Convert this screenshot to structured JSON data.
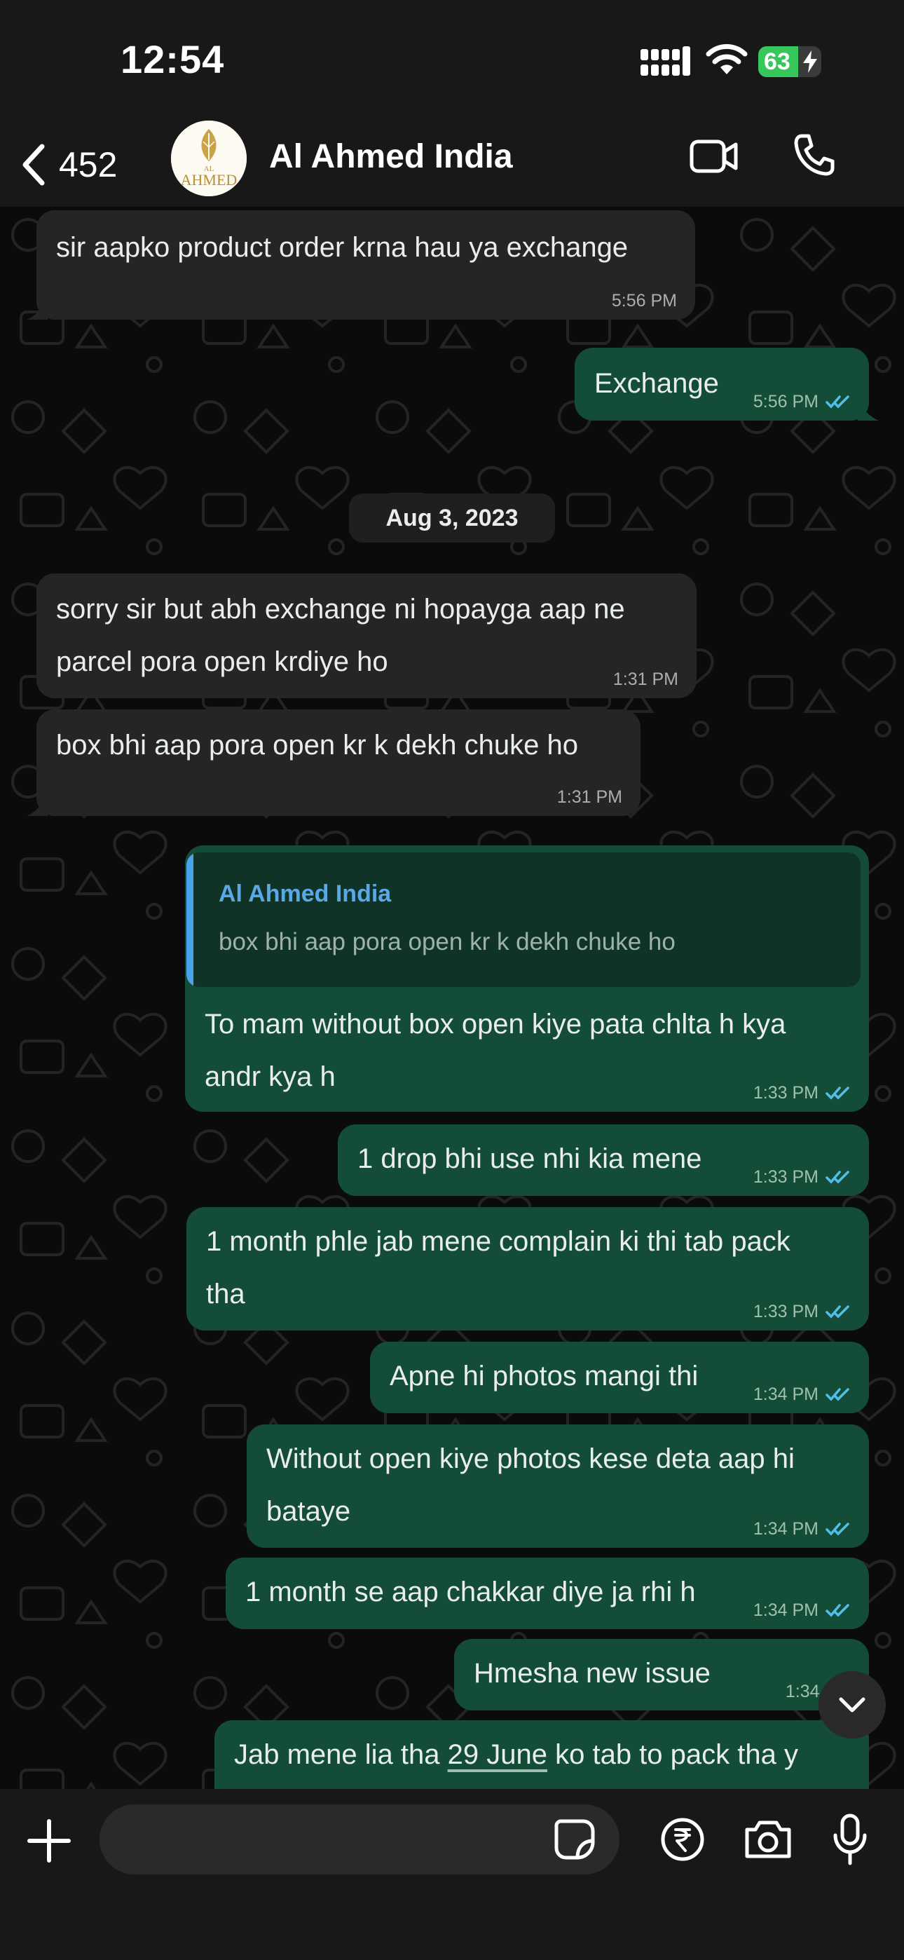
{
  "status": {
    "time": "12:54",
    "battery": "63",
    "battery_level": 0.63
  },
  "header": {
    "back_count": "452",
    "contact_name": "Al Ahmed India",
    "avatar_text": "AL AHMED"
  },
  "messages": [
    {
      "dir": "in",
      "lines": [
        "sir aapko product order krna hau ya exchange"
      ],
      "time": "5:56 PM"
    },
    {
      "dir": "out",
      "lines": [
        "Exchange"
      ],
      "time": "5:56 PM"
    },
    {
      "dir": "in",
      "lines": [
        "sorry sir but abh exchange ni hopayga aap ne",
        "parcel pora open krdiye ho"
      ],
      "time": "1:31 PM"
    },
    {
      "dir": "in",
      "lines": [
        "box bhi aap pora open kr k dekh chuke ho"
      ],
      "time": "1:31 PM"
    },
    {
      "dir": "out",
      "lines": [
        "To mam without box  open kiye pata chlta h kya",
        "andr kya h"
      ],
      "time": "1:33 PM"
    },
    {
      "dir": "out",
      "lines": [
        "1 drop bhi use nhi kia mene"
      ],
      "time": "1:33 PM"
    },
    {
      "dir": "out",
      "lines": [
        "1 month phle jab mene complain ki thi tab pack",
        "tha"
      ],
      "time": "1:33 PM"
    },
    {
      "dir": "out",
      "lines": [
        "Apne hi photos mangi thi"
      ],
      "time": "1:34 PM"
    },
    {
      "dir": "out",
      "lines": [
        "Without open kiye photos kese deta aap hi",
        "bataye"
      ],
      "time": "1:34 PM"
    },
    {
      "dir": "out",
      "lines": [
        "1 month se aap chakkar diye ja rhi h"
      ],
      "time": "1:34 PM"
    },
    {
      "dir": "out",
      "lines": [
        "Hmesha new issue"
      ],
      "time": "1:34 PM"
    },
    {
      "dir": "out",
      "lines": [
        "Jab mene lia tha ",
        "29 June",
        " ko tab to pack tha y"
      ],
      "time": ""
    }
  ],
  "date_divider": "Aug 3, 2023",
  "reply_quote": {
    "author": "Al Ahmed India",
    "text": "box bhi aap pora open kr k dekh chuke ho"
  },
  "input": {
    "placeholder": ""
  },
  "colors": {
    "incoming": "#252525",
    "outgoing": "#134d37",
    "read_tick": "#53bdeb",
    "quote_accent": "#4aa3e6"
  }
}
